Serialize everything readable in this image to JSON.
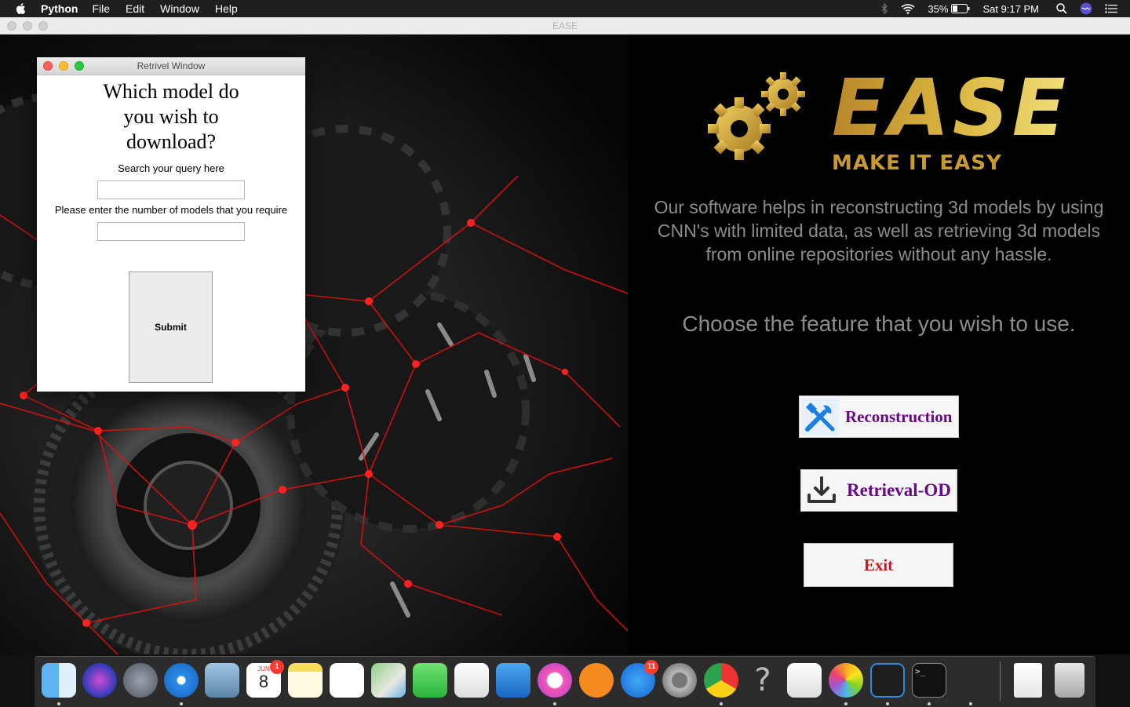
{
  "menubar": {
    "app_name": "Python",
    "items": [
      "File",
      "Edit",
      "Window",
      "Help"
    ],
    "battery": "35%",
    "clock": "Sat 9:17 PM"
  },
  "window": {
    "title": "EASE"
  },
  "logo": {
    "title": "EASE",
    "tagline": "MAKE IT EASY"
  },
  "main": {
    "description": "Our software helps in reconstructing 3d models by using CNN's with limited data, as well as retrieving 3d models from online repositories without any hassle.",
    "prompt": "Choose the feature that you wish to use.",
    "buttons": {
      "reconstruction": "Reconstruction",
      "retrieval": "Retrieval-OD",
      "exit": "Exit"
    }
  },
  "popup": {
    "title": "Retrivel Window",
    "question": "Which model do you wish to download?",
    "search_label": "Search your query here",
    "search_value": "",
    "count_label": "Please enter the number of models that you require",
    "count_value": "",
    "submit_label": "Submit"
  },
  "dock": {
    "calendar_month": "JUN",
    "calendar_day": "8",
    "calendar_badge": "1",
    "appstore_badge": "11",
    "apps": [
      "finder-icon",
      "siri-icon",
      "launchpad-icon",
      "safari-icon",
      "mail-icon",
      "calendar-icon",
      "notes-icon",
      "reminders-icon",
      "maps-icon",
      "facetime-icon",
      "numbers-icon",
      "keynote-icon",
      "itunes-icon",
      "ibooks-icon",
      "app-store-icon",
      "system-preferences-icon",
      "chrome-icon",
      "help-icon",
      "pages-icon",
      "photos-icon",
      "vscode-icon",
      "terminal-icon",
      "rocket-icon",
      "html-file-icon",
      "trash-icon"
    ]
  },
  "colors": {
    "accent_purple": "#6a0a8a",
    "exit_red": "#e0101a",
    "logo_gold": "#d4a92a",
    "text_gray": "#8c8c8c"
  }
}
